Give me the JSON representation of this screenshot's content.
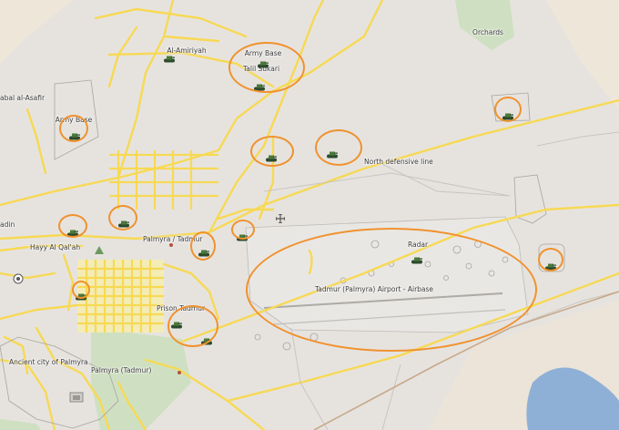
{
  "map": {
    "labels": {
      "al_amiriyah": "Al-Amiriyah",
      "army_base_1": "Army Base",
      "talil_sukari": "Talil Sukari",
      "jabal_al_asafir": "abal al-Asafir",
      "army_base_2": "Army Base",
      "orchards": "Orchards",
      "north_defensive_line": "North defensive line",
      "adin": "adin",
      "hayy_al_qalah": "Hayy Al Qal'ah",
      "palmyra_tadmur_city": "Palmyra / Tadmur",
      "radar": "Radar",
      "airport": "Tadmur (Palmyra) Airport - Airbase",
      "prison": "Prison Tadmur",
      "ancient_city": "Ancient city of Palmyra",
      "palmyra_tadmur": "Palmyra (Tadmur)"
    },
    "colors": {
      "background": "#e6e3df",
      "road": "#f7d954",
      "highlight_ring": "#f0922e",
      "green_area": "#cfe0c2",
      "water": "#8fb0d6",
      "desert": "#efe6da"
    },
    "icons": [
      "tank-icon",
      "crosshair-icon",
      "pitch-icon",
      "castle-icon"
    ]
  }
}
